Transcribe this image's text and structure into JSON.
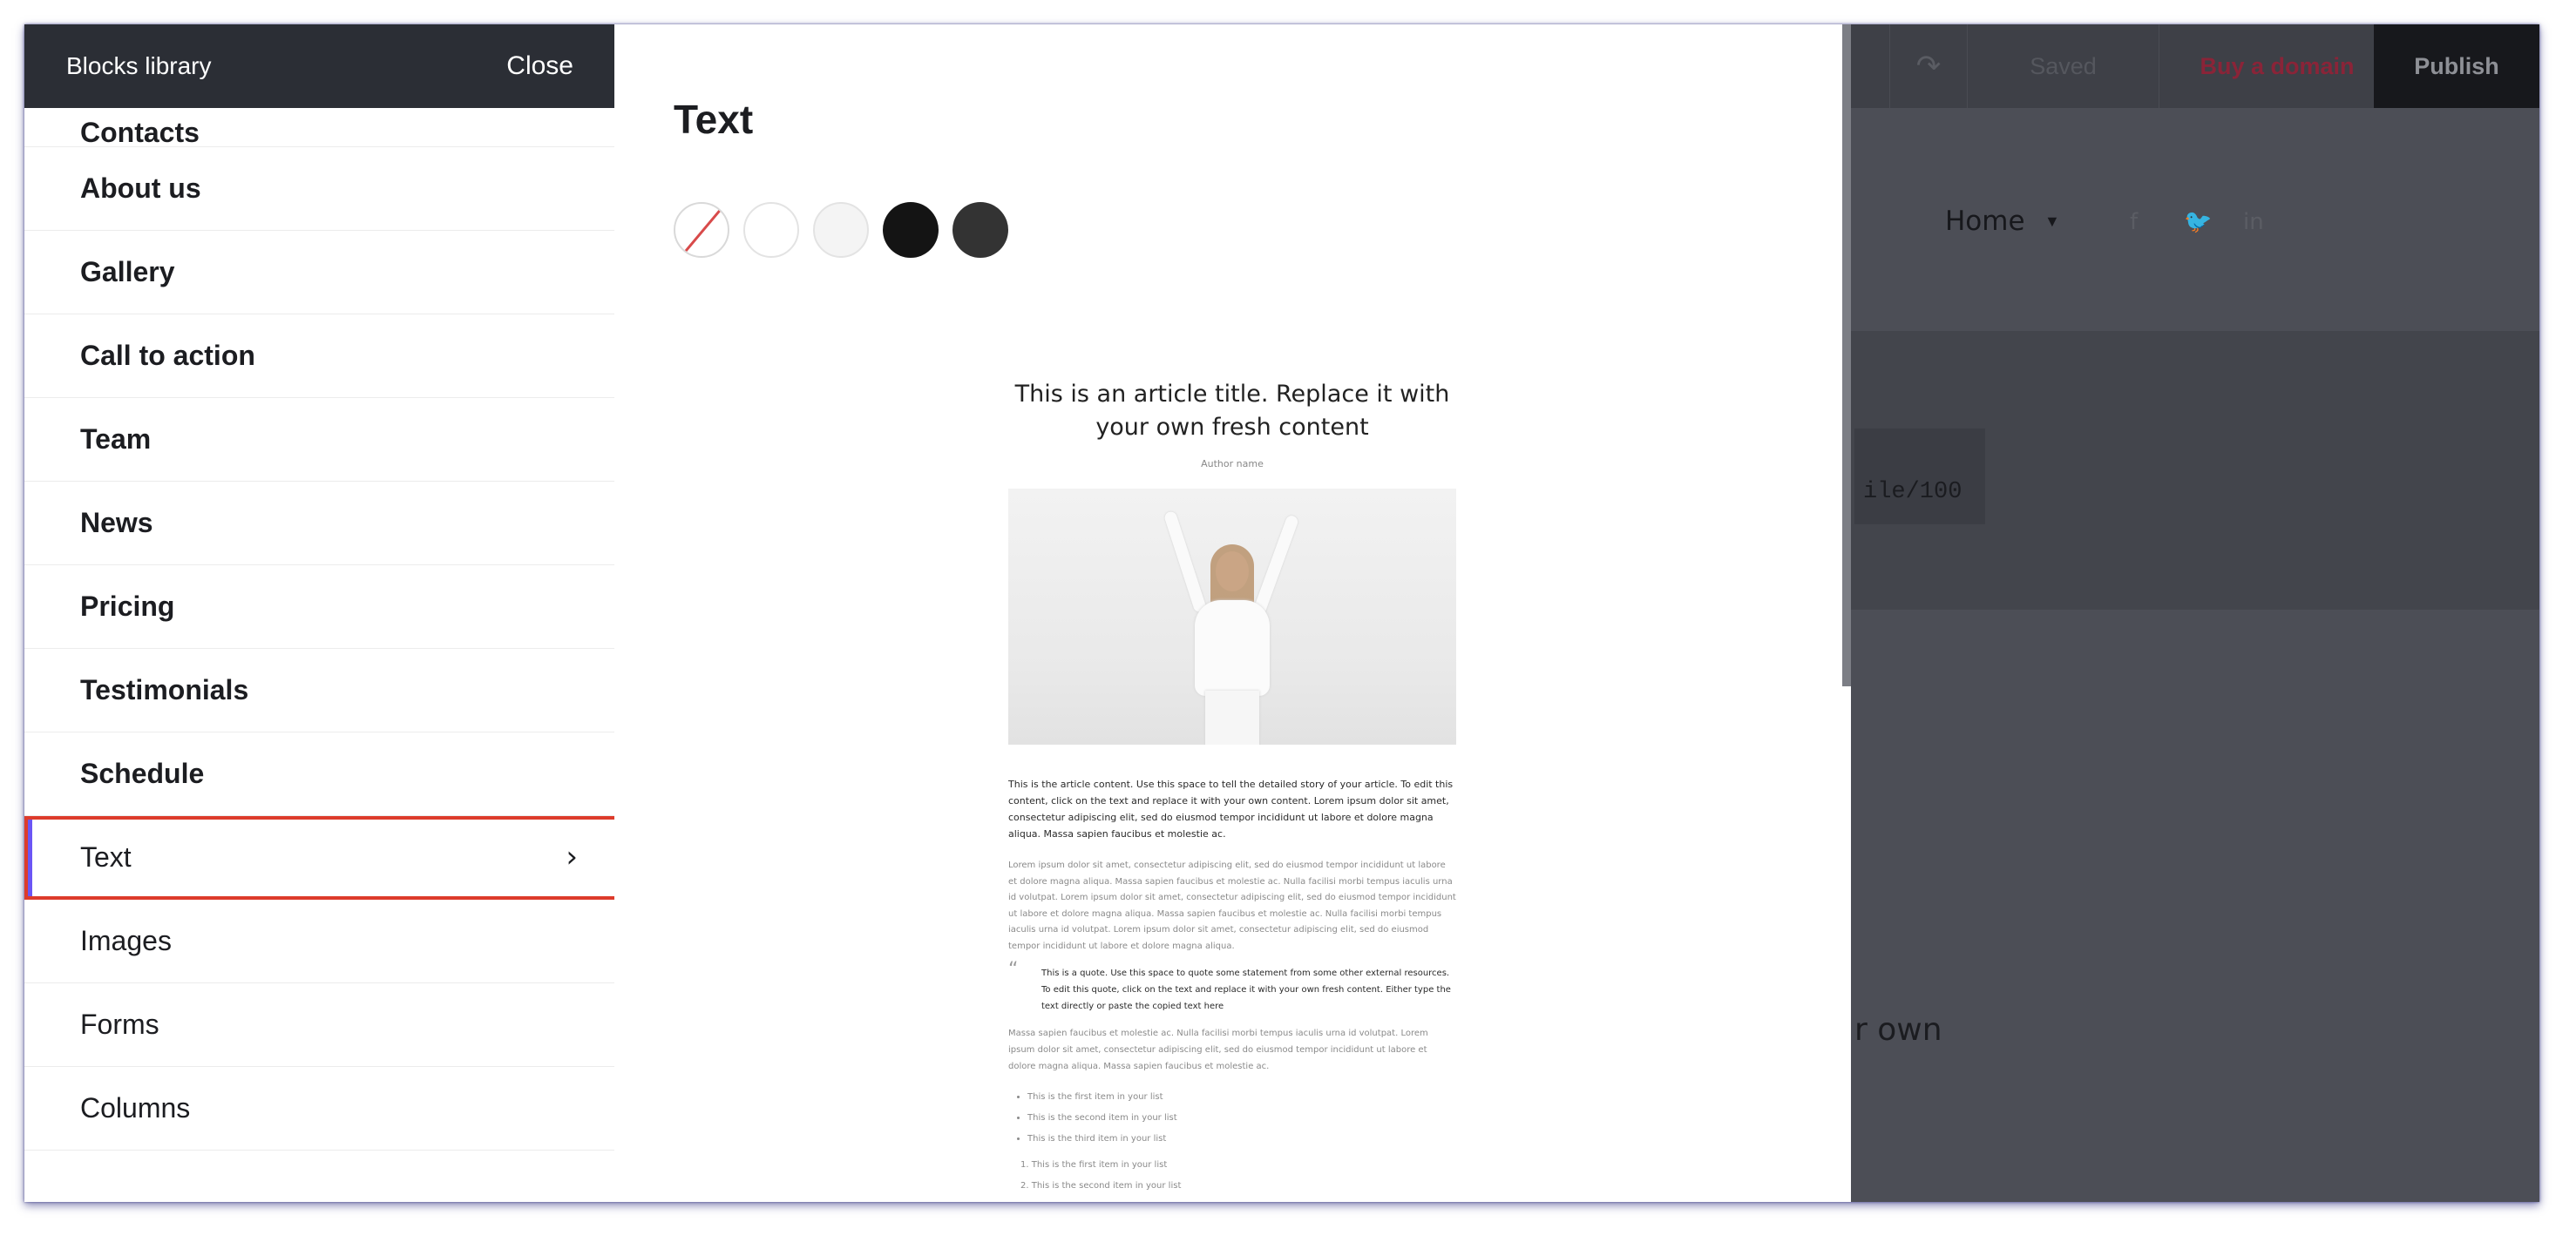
{
  "background_editor": {
    "saved_label": "Saved",
    "buy_domain_label": "Buy a domain",
    "publish_label": "Publish",
    "redo_icon": "redo-icon",
    "nav_home_label": "Home",
    "code_snippet": "ile/100",
    "fragment_text": "r own",
    "social_icons": [
      "facebook-icon",
      "twitter-icon",
      "linkedin-icon"
    ]
  },
  "library": {
    "title": "Blocks library",
    "close_label": "Close",
    "items": [
      {
        "label": "Contacts"
      },
      {
        "label": "About us"
      },
      {
        "label": "Gallery"
      },
      {
        "label": "Call to action"
      },
      {
        "label": "Team"
      },
      {
        "label": "News"
      },
      {
        "label": "Pricing"
      },
      {
        "label": "Testimonials"
      },
      {
        "label": "Schedule"
      },
      {
        "label": "Text"
      },
      {
        "label": "Images"
      },
      {
        "label": "Forms"
      },
      {
        "label": "Columns"
      }
    ],
    "selected": "Text"
  },
  "preview": {
    "title": "Text",
    "swatches": [
      "none",
      "#ffffff",
      "#f4f4f4",
      "#141414",
      "#333333"
    ],
    "article": {
      "title": "This is an article title. Replace it with your own fresh content",
      "author": "Author name",
      "lead": "This is the article content. Use this space to tell the detailed story of your article. To edit this content, click on the text and replace it with your own content. Lorem ipsum dolor sit amet, consectetur adipiscing elit, sed do eiusmod tempor incididunt ut labore et dolore magna aliqua. Massa sapien faucibus et molestie ac.",
      "body": "Lorem ipsum dolor sit amet, consectetur adipiscing elit, sed do eiusmod tempor incididunt ut labore et dolore magna aliqua. Massa sapien faucibus et molestie ac. Nulla facilisi morbi tempus iaculis urna id volutpat. Lorem ipsum dolor sit amet, consectetur adipiscing elit, sed do eiusmod tempor incididunt ut labore et dolore magna aliqua. Massa sapien faucibus et molestie ac. Nulla facilisi morbi tempus iaculis urna id volutpat. Lorem ipsum dolor sit amet, consectetur adipiscing elit, sed do eiusmod tempor incididunt ut labore et dolore magna aliqua.",
      "quote": "This is a quote. Use this space to quote some statement from some other external resources. To edit this quote, click on the text and replace it with your own fresh content. Either type the text directly or paste the copied text here",
      "body2": "Massa sapien faucibus et molestie ac. Nulla facilisi morbi tempus iaculis urna id volutpat. Lorem ipsum dolor sit amet, consectetur adipiscing elit, sed do eiusmod tempor incididunt ut labore et dolore magna aliqua. Massa sapien faucibus et molestie ac.",
      "bullet_list": [
        "This is the first item in your list",
        "This is the second item in your list",
        "This is the third item in your list"
      ],
      "numbered_list": [
        "This is the first item in your list",
        "This is the second item in your list"
      ]
    }
  }
}
